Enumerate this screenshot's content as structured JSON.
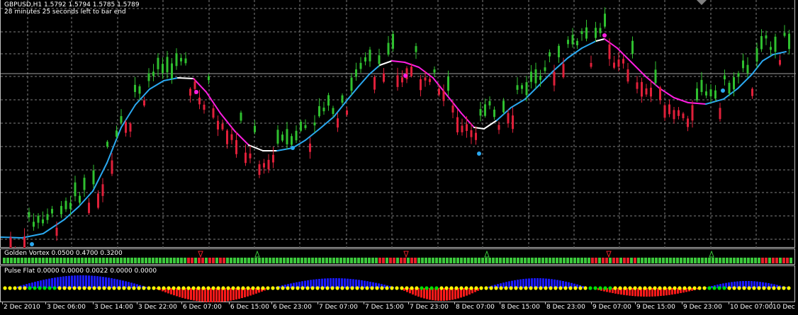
{
  "chart": {
    "symbol_info": "GBPUSD,H1  1.5792 1.5794 1.5785 1.5789",
    "countdown": "28 minutes 25 seconds left to bar end"
  },
  "vortex": {
    "title": "Golden Vortex 0.0500 0.4700 0.3200"
  },
  "pulse": {
    "title": "Pulse Flat 0.0000 0.0000 0.0022 0.0000 0.0000"
  },
  "time_axis": {
    "labels": [
      "2 Dec 2010",
      "3 Dec 06:00",
      "3 Dec 14:00",
      "3 Dec 22:00",
      "6 Dec 07:00",
      "6 Dec 15:00",
      "6 Dec 23:00",
      "7 Dec 07:00",
      "7 Dec 15:00",
      "7 Dec 23:00",
      "8 Dec 07:00",
      "8 Dec 15:00",
      "8 Dec 23:00",
      "9 Dec 07:00",
      "9 Dec 15:00",
      "9 Dec 23:00",
      "10 Dec 07:00",
      "10 Dec"
    ]
  },
  "colors": {
    "background": "#000000",
    "grid": "#808080",
    "bull_candle": "#2fbf2f",
    "bear_candle": "#e0203a",
    "ma_up": "#2aa8f0",
    "ma_down": "#ff1ee0",
    "ma_flat": "#ffffff",
    "vortex_up": "#3cc83c",
    "vortex_down": "#e8202a",
    "pulse_up": "#1a1aff",
    "pulse_down": "#ff1a1a",
    "dot_neutral": "#ffff00",
    "dot_active": "#00e000"
  },
  "icons": {
    "scroll_marker": "diamond-icon",
    "signal_arrow": "arrow-icon"
  }
}
